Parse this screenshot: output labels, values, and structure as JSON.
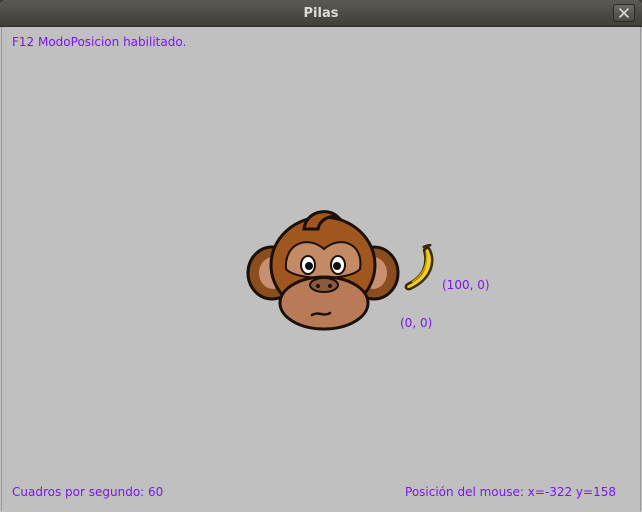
{
  "window": {
    "title": "Pilas",
    "close_icon": "close-icon"
  },
  "overlay": {
    "mode_message": "F12 ModoPosicion habilitado.",
    "fps_label": "Cuadros por segundo: 60",
    "mouse_position_label": "Posición del mouse: x=-322 y=158",
    "text_color": "#7b17e8"
  },
  "actors": [
    {
      "name": "monkey",
      "icon": "monkey-face-icon",
      "coordinate_label": "(0, 0)"
    },
    {
      "name": "banana",
      "icon": "banana-icon",
      "coordinate_label": "(100, 0)"
    }
  ],
  "colors": {
    "canvas_background": "#c0c0c0",
    "titlebar": "#4a4944"
  }
}
